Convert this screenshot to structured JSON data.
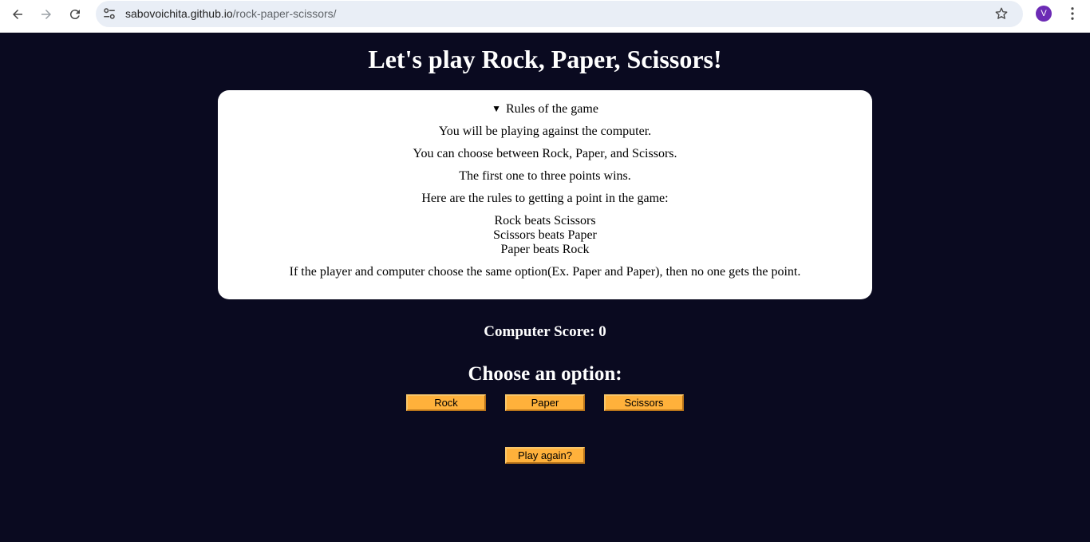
{
  "browser": {
    "url_host": "sabovoichita.github.io",
    "url_path": "/rock-paper-scissors/",
    "avatar_letter": "V"
  },
  "page": {
    "title": "Let's play Rock, Paper, Scissors!",
    "rules": {
      "summary": "Rules of the game",
      "lines": [
        "You will be playing against the computer.",
        "You can choose between Rock, Paper, and Scissors.",
        "The first one to three points wins.",
        "Here are the rules to getting a point in the game:",
        "Rock beats Scissors",
        "Scissors beats Paper",
        "Paper beats Rock",
        "If the player and computer choose the same option(Ex. Paper and Paper), then no one gets the point."
      ]
    },
    "score": {
      "label": "Computer Score:",
      "value": "0"
    },
    "choose_heading": "Choose an option:",
    "options": [
      "Rock",
      "Paper",
      "Scissors"
    ],
    "play_again": "Play again?"
  },
  "colors": {
    "background": "#0a0a20",
    "button": "#ffb13b",
    "card": "#ffffff"
  }
}
